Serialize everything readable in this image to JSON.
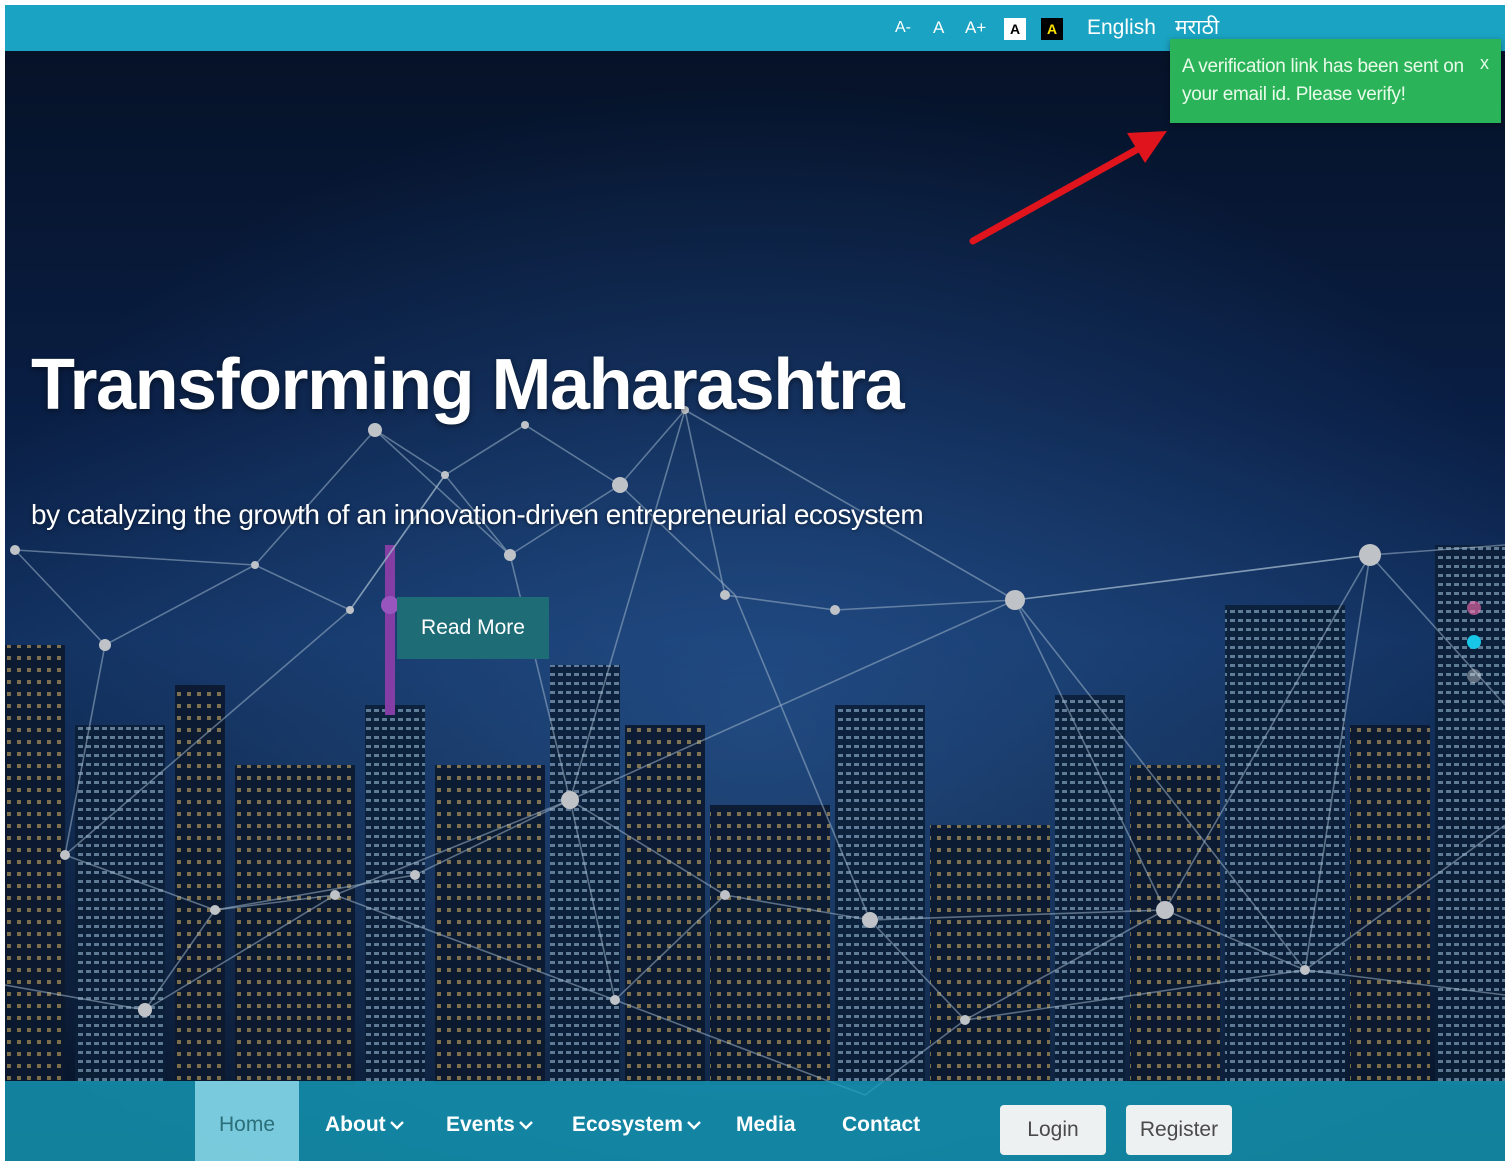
{
  "topbar": {
    "font_smaller": "A-",
    "font_normal": "A",
    "font_larger": "A+",
    "contrast_default": "A",
    "contrast_high": "A",
    "lang_english": "English",
    "lang_marathi": "मराठी"
  },
  "toast": {
    "message": "A verification link has been sent on your email id. Please verify!",
    "close": "x"
  },
  "hero": {
    "title": "Transforming Maharashtra",
    "subtitle": "by catalyzing the growth of an innovation-driven entrepreneurial ecosystem",
    "cta": "Read More"
  },
  "nav": {
    "items": [
      {
        "label": "Home",
        "active": true
      },
      {
        "label": "About",
        "dropdown": true
      },
      {
        "label": "Events",
        "dropdown": true
      },
      {
        "label": "Ecosystem",
        "dropdown": true
      },
      {
        "label": "Media"
      },
      {
        "label": "Contact"
      }
    ],
    "login": "Login",
    "register": "Register"
  },
  "colors": {
    "topbar": "#1aa3c2",
    "toast": "#2bb35a",
    "cta": "#1e6d76",
    "annotation_arrow": "#e0141c"
  }
}
